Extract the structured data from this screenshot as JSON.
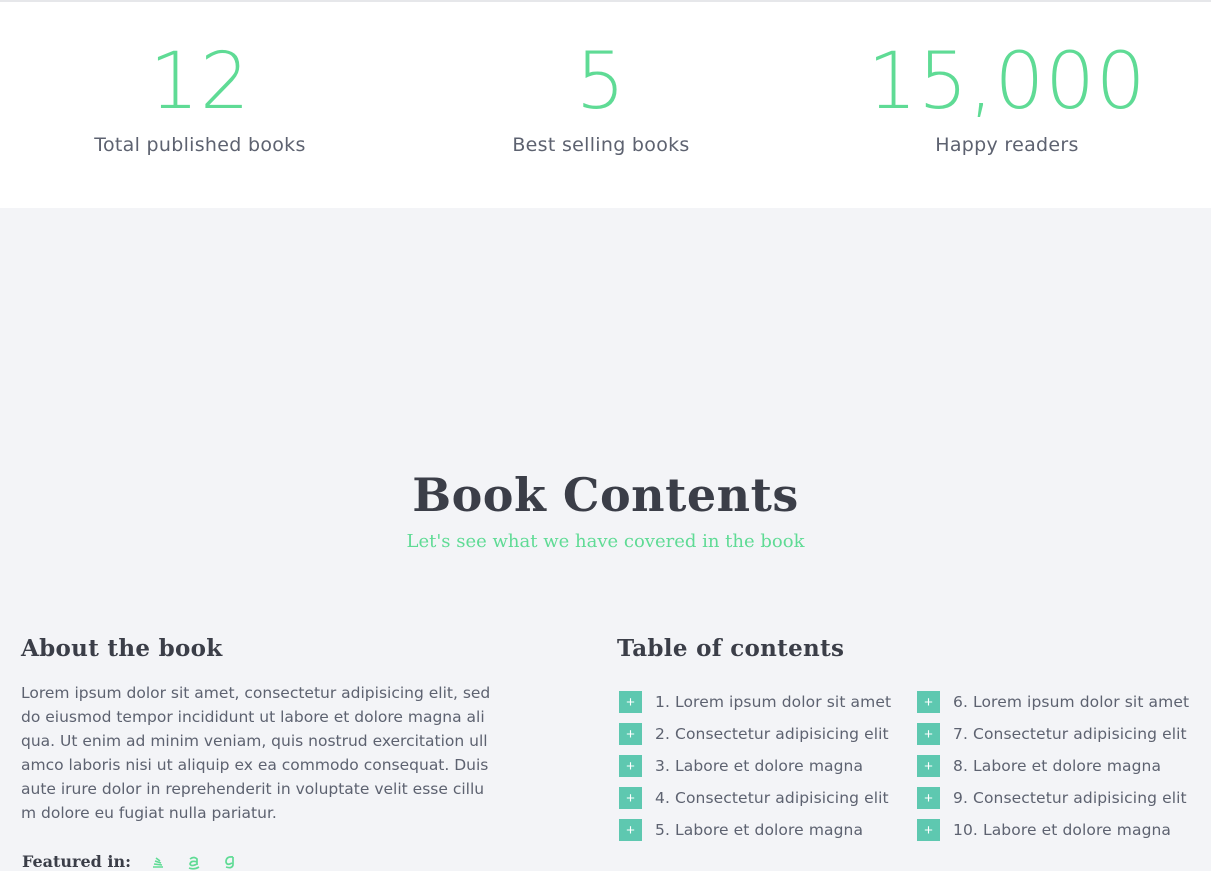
{
  "stats": [
    {
      "value": "12",
      "label": "Total published books"
    },
    {
      "value": "5",
      "label": "Best selling books"
    },
    {
      "value": "15,000",
      "label": "Happy readers"
    }
  ],
  "contents": {
    "title": "Book Contents",
    "subtitle": "Let's see what we have covered in the book"
  },
  "about": {
    "heading": "About the book",
    "text": "Lorem ipsum dolor sit amet, consectetur adipisicing elit, sed do eiusmod tempor incididunt ut labore et dolore magna aliqua. Ut enim ad minim veniam, quis nostrud exercitation ullamco laboris nisi ut aliquip ex ea commodo consequat. Duis aute irure dolor in reprehenderit in voluptate velit esse cillum dolore eu fugiat nulla pariatur.",
    "featured_label": "Featured in:",
    "featured_icons": [
      "stack-icon",
      "amazon-icon",
      "goodreads-icon"
    ]
  },
  "toc": {
    "heading": "Table of contents",
    "plus_glyph": "+",
    "left": [
      "1. Lorem ipsum dolor sit amet",
      "2. Consectetur adipisicing elit",
      "3. Labore et dolore magna",
      "4. Consectetur adipisicing elit",
      "5. Labore et dolore magna"
    ],
    "right": [
      "6. Lorem ipsum dolor sit amet",
      "7. Consectetur adipisicing elit",
      "8. Labore et dolore magna",
      "9. Consectetur adipisicing elit",
      "10. Labore et dolore magna"
    ]
  },
  "colors": {
    "accent": "#5fdb95",
    "plus_box": "#5ec8b0",
    "heading": "#3b3e48",
    "text": "#5d6270",
    "section_bg": "#f3f4f7"
  }
}
